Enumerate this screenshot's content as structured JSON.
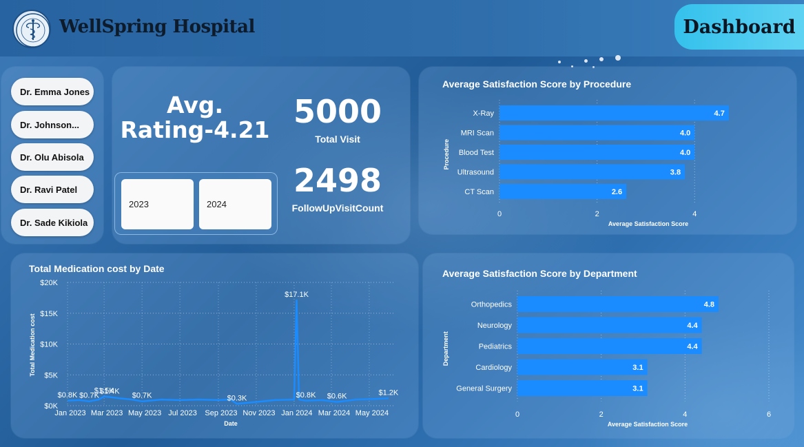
{
  "header": {
    "hospital_name": "WellSpring Hospital",
    "dashboard_label": "Dashboard",
    "logo_name": "hospital-logo"
  },
  "doctors": {
    "items": [
      {
        "label": "Dr. Emma Jones"
      },
      {
        "label": "Dr. Johnson..."
      },
      {
        "label": "Dr. Olu Abisola"
      },
      {
        "label": "Dr. Ravi Patel"
      },
      {
        "label": "Dr. Sade Kikiola"
      }
    ]
  },
  "kpi": {
    "avg_rating_line1": "Avg.",
    "avg_rating_line2": "Rating-4.21",
    "total_visit_value": "5000",
    "total_visit_label": "Total Visit",
    "followup_value": "2498",
    "followup_label": "FollowUpVisitCount",
    "years": [
      "2023",
      "2024"
    ]
  },
  "colors": {
    "bar": "#1a8cff",
    "line": "#1a8cff",
    "accent": "#34c1ec"
  },
  "chart_data": [
    {
      "type": "bar",
      "orientation": "horizontal",
      "title": "Average Satisfaction Score by Procedure",
      "xlabel": "Average Satisfaction Score",
      "ylabel": "Procedure",
      "categories": [
        "X-Ray",
        "MRI Scan",
        "Blood Test",
        "Ultrasound",
        "CT Scan"
      ],
      "values": [
        4.7,
        4.0,
        4.0,
        3.8,
        2.6
      ],
      "value_labels": [
        "4.7",
        "4.0",
        "4.0",
        "3.8",
        "2.6"
      ],
      "xlim": [
        0,
        4.9
      ],
      "xticks": [
        0,
        2,
        4
      ],
      "grid": true
    },
    {
      "type": "line",
      "title": "Total Medication cost by Date",
      "xlabel": "Date",
      "ylabel": "Total Medication cost",
      "x_tick_labels": [
        "Jan 2023",
        "Mar 2023",
        "May 2023",
        "Jul 2023",
        "Sep 2023",
        "Nov 2023",
        "Jan 2024",
        "Mar 2024",
        "May 2024"
      ],
      "y_tick_labels": [
        "$0K",
        "$5K",
        "$10K",
        "$15K",
        "$20K"
      ],
      "ylim": [
        0,
        20
      ],
      "grid": true,
      "points": [
        {
          "x": "2023-01-01",
          "y": 0.8
        },
        {
          "x": "2023-01-20",
          "y": 0.9
        },
        {
          "x": "2023-02-05",
          "y": 0.7
        },
        {
          "x": "2023-02-20",
          "y": 1.0
        },
        {
          "x": "2023-03-01",
          "y": 1.5
        },
        {
          "x": "2023-03-10",
          "y": 1.4
        },
        {
          "x": "2023-03-25",
          "y": 1.2
        },
        {
          "x": "2023-04-15",
          "y": 1.0
        },
        {
          "x": "2023-05-01",
          "y": 0.7
        },
        {
          "x": "2023-06-01",
          "y": 1.0
        },
        {
          "x": "2023-07-01",
          "y": 0.9
        },
        {
          "x": "2023-08-01",
          "y": 1.0
        },
        {
          "x": "2023-09-01",
          "y": 0.9
        },
        {
          "x": "2023-09-20",
          "y": 1.0
        },
        {
          "x": "2023-10-01",
          "y": 0.3
        },
        {
          "x": "2023-11-01",
          "y": 0.6
        },
        {
          "x": "2023-12-01",
          "y": 0.9
        },
        {
          "x": "2024-01-01",
          "y": 1.0
        },
        {
          "x": "2024-01-05",
          "y": 17.1
        },
        {
          "x": "2024-01-09",
          "y": 1.0
        },
        {
          "x": "2024-01-20",
          "y": 0.8
        },
        {
          "x": "2024-02-15",
          "y": 0.9
        },
        {
          "x": "2024-03-10",
          "y": 0.6
        },
        {
          "x": "2024-04-10",
          "y": 1.0
        },
        {
          "x": "2024-05-10",
          "y": 1.1
        },
        {
          "x": "2024-06-01",
          "y": 1.2
        }
      ],
      "data_labels": [
        {
          "x": "2023-01-01",
          "y": 0.8,
          "text": "$0.8K"
        },
        {
          "x": "2023-02-05",
          "y": 0.7,
          "text": "$0.7K"
        },
        {
          "x": "2023-03-01",
          "y": 1.5,
          "text": "$1.5K"
        },
        {
          "x": "2023-03-10",
          "y": 1.4,
          "text": "$1.4K"
        },
        {
          "x": "2023-05-01",
          "y": 0.7,
          "text": "$0.7K"
        },
        {
          "x": "2023-10-01",
          "y": 0.3,
          "text": "$0.3K"
        },
        {
          "x": "2024-01-05",
          "y": 17.1,
          "text": "$17.1K"
        },
        {
          "x": "2024-01-20",
          "y": 0.8,
          "text": "$0.8K"
        },
        {
          "x": "2024-03-10",
          "y": 0.6,
          "text": "$0.6K"
        },
        {
          "x": "2024-06-01",
          "y": 1.2,
          "text": "$1.2K"
        }
      ]
    },
    {
      "type": "bar",
      "orientation": "horizontal",
      "title": "Average Satisfaction Score by Department",
      "xlabel": "Average Satisfaction Score",
      "ylabel": "Department",
      "categories": [
        "Orthopedics",
        "Neurology",
        "Pediatrics",
        "Cardiology",
        "General Surgery"
      ],
      "values": [
        4.8,
        4.4,
        4.4,
        3.1,
        3.1
      ],
      "value_labels": [
        "4.8",
        "4.4",
        "4.4",
        "3.1",
        "3.1"
      ],
      "xlim": [
        0,
        6
      ],
      "xticks": [
        0,
        2,
        4,
        6
      ],
      "grid": true
    }
  ]
}
